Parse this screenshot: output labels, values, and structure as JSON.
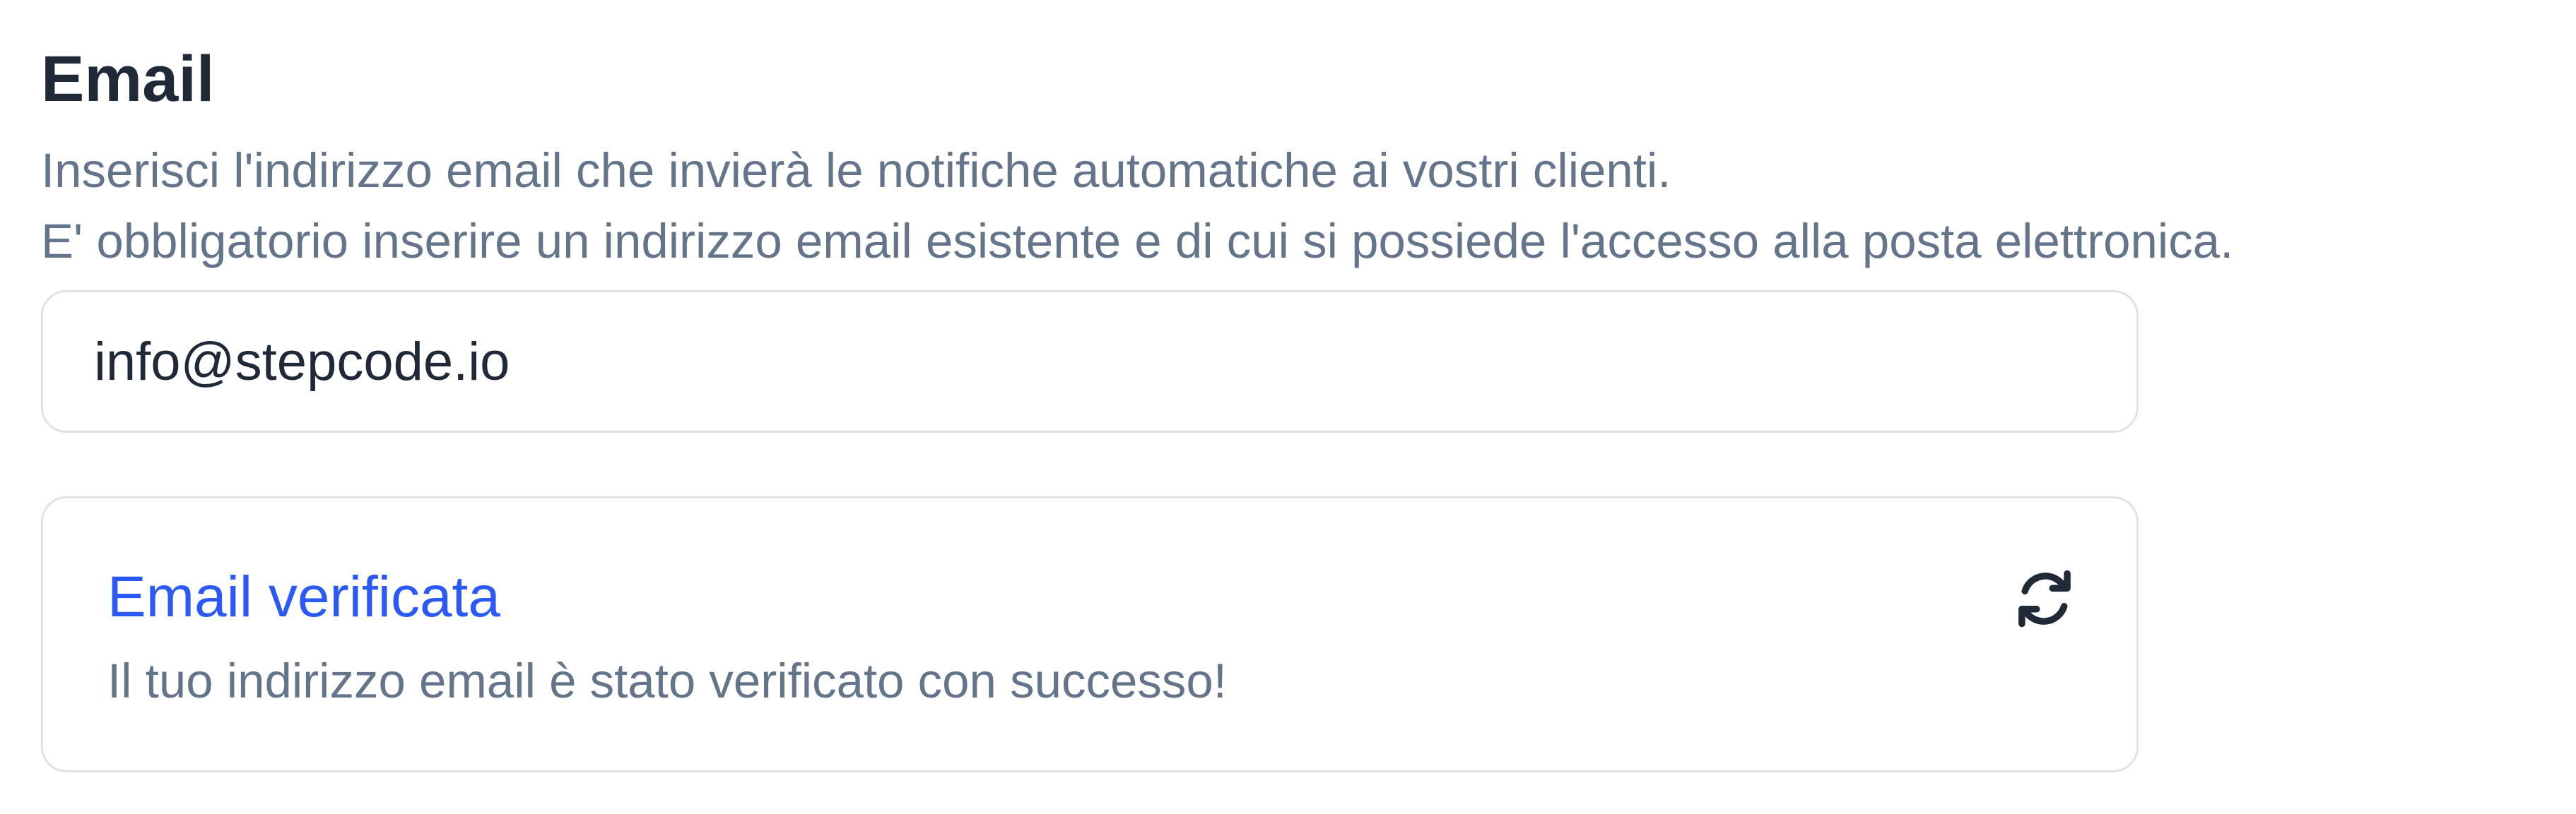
{
  "email_section": {
    "title": "Email",
    "description_lines": [
      "Inserisci l'indirizzo email che invierà le notifiche automatiche ai vostri clienti.",
      "E' obbligatorio inserire un indirizzo email esistente e di cui si possiede l'accesso alla posta elettronica."
    ],
    "email_value": "info@stepcode.io"
  },
  "verification_card": {
    "title": "Email verificata",
    "message": "Il tuo indirizzo email è stato verificato con successo!",
    "refresh_icon": "refresh-icon"
  },
  "colors": {
    "heading": "#1f2937",
    "muted_text": "#64748b",
    "accent_blue": "#2b59f5",
    "border": "#dfe3e8"
  }
}
